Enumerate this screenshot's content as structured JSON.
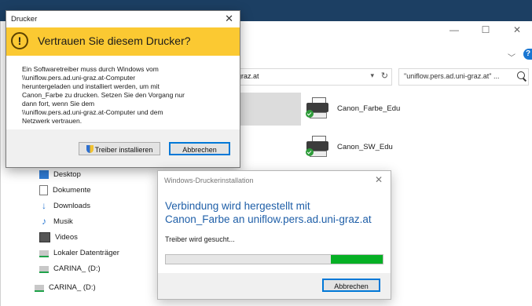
{
  "explorer": {
    "address": "graz.at",
    "search": "\"uniflow.pers.ad.uni-graz.at\" ...",
    "window_buttons": [
      "—",
      "☐",
      "✕"
    ],
    "help_badge": "?",
    "printers": [
      {
        "name": "Canon_Farbe_Edu",
        "icon": "printer-icon"
      },
      {
        "name": "Canon_SW_Edu",
        "icon": "printer-icon"
      }
    ],
    "nav": [
      {
        "label": "Desktop",
        "icon": "desktop-icon"
      },
      {
        "label": "Dokumente",
        "icon": "document-icon"
      },
      {
        "label": "Downloads",
        "icon": "download-icon"
      },
      {
        "label": "Musik",
        "icon": "music-icon"
      },
      {
        "label": "Videos",
        "icon": "video-icon"
      },
      {
        "label": "Lokaler Datenträger",
        "icon": "drive-icon"
      },
      {
        "label": "CARINA_ (D:)",
        "icon": "drive-icon"
      },
      {
        "label": "CARINA_ (D:)",
        "icon": "drive-icon"
      }
    ]
  },
  "trust_dialog": {
    "title": "Drucker",
    "heading": "Vertrauen Sie diesem Drucker?",
    "body": [
      "Ein Softwaretreiber muss durch Windows vom",
      "\\\\uniflow.pers.ad.uni-graz.at-Computer",
      "heruntergeladen und installiert werden, um mit",
      "Canon_Farbe zu drucken. Setzen Sie den Vorgang nur",
      "dann fort, wenn Sie dem",
      "\\\\uniflow.pers.ad.uni-graz.at-Computer und dem",
      "Netzwerk vertrauen."
    ],
    "install_button": "Treiber installieren",
    "cancel_button": "Abbrechen",
    "warning_glyph": "!",
    "accent": "#fbc932"
  },
  "progress_dialog": {
    "title": "Windows-Druckerinstallation",
    "heading": "Verbindung wird hergestellt mit Canon_Farbe an uniflow.pers.ad.uni-graz.at",
    "status": "Treiber wird gesucht...",
    "progress_indeterminate": true,
    "cancel_button": "Abbrechen",
    "accent": "#06b025"
  }
}
